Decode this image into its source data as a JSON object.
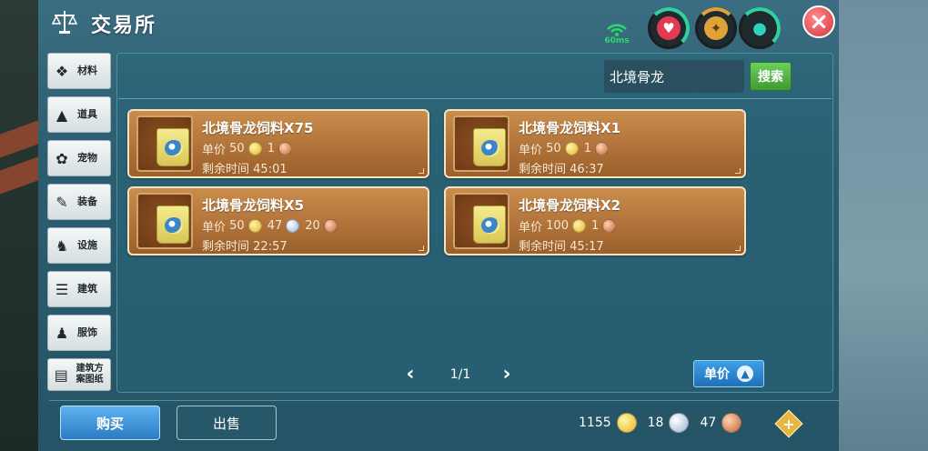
{
  "window": {
    "title": "交易所"
  },
  "status": {
    "ping_label": "60ms"
  },
  "sidebar": {
    "items": [
      {
        "label": "材料",
        "icon": "materials-icon"
      },
      {
        "label": "道具",
        "icon": "props-icon"
      },
      {
        "label": "宠物",
        "icon": "pet-paw-icon"
      },
      {
        "label": "装备",
        "icon": "equipment-icon"
      },
      {
        "label": "设施",
        "icon": "facility-icon"
      },
      {
        "label": "建筑",
        "icon": "building-icon"
      },
      {
        "label": "服饰",
        "icon": "clothing-icon"
      },
      {
        "label": "建筑方案图纸",
        "icon": "blueprint-icon"
      }
    ]
  },
  "search": {
    "value": "北境骨龙",
    "button_label": "搜索"
  },
  "listings": [
    {
      "name": "北境骨龙饲料X75",
      "price_label": "单价",
      "gold": "50",
      "silver": "",
      "copper": "1",
      "time_label": "剩余时间",
      "time": "45:01"
    },
    {
      "name": "北境骨龙饲料X1",
      "price_label": "单价",
      "gold": "50",
      "silver": "",
      "copper": "1",
      "time_label": "剩余时间",
      "time": "46:37"
    },
    {
      "name": "北境骨龙饲料X5",
      "price_label": "单价",
      "gold": "50",
      "silver": "47",
      "copper": "20",
      "time_label": "剩余时间",
      "time": "22:57"
    },
    {
      "name": "北境骨龙饲料X2",
      "price_label": "单价",
      "gold": "100",
      "silver": "",
      "copper": "1",
      "time_label": "剩余时间",
      "time": "45:17"
    }
  ],
  "pagination": {
    "label": "1/1"
  },
  "sort": {
    "label": "单价"
  },
  "tabs": {
    "buy": "购买",
    "sell": "出售"
  },
  "wallet": {
    "gold": "1155",
    "silver": "18",
    "copper": "47"
  },
  "colors": {
    "accent_blue": "#2a7cc4",
    "search_green": "#3e9a35",
    "card_brown": "#b1733a",
    "close_red": "#d4343c"
  }
}
